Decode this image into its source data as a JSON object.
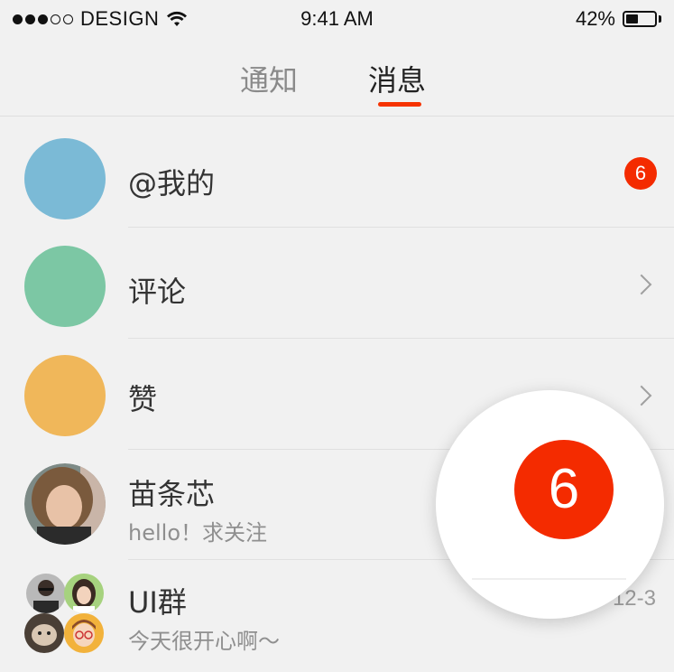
{
  "status_bar": {
    "carrier": "DESIGN",
    "time": "9:41 AM",
    "battery_percent": "42%",
    "battery_level": 0.42,
    "signal_dots_filled": 3,
    "signal_dots_total": 5,
    "icons": [
      "signal-dots-icon",
      "wifi-icon",
      "battery-icon"
    ]
  },
  "tabs": [
    {
      "label": "通知",
      "active": false
    },
    {
      "label": "消息",
      "active": true
    }
  ],
  "accent_color": "#f63300",
  "rows": [
    {
      "title": "@我的",
      "badge": "6",
      "avatar_color": "#7bbad6"
    },
    {
      "title": "评论",
      "avatar_color": "#7cc7a4",
      "trailing": "chevron-right-icon"
    },
    {
      "title": "赞",
      "avatar_color": "#f0b75a",
      "trailing": "chevron-right-icon"
    },
    {
      "title": "苗条芯",
      "subtitle": "hello！求关注"
    },
    {
      "title": "UI群",
      "subtitle": "今天很开心啊～",
      "time": "12-3"
    }
  ],
  "magnifier": {
    "badge": "6"
  }
}
